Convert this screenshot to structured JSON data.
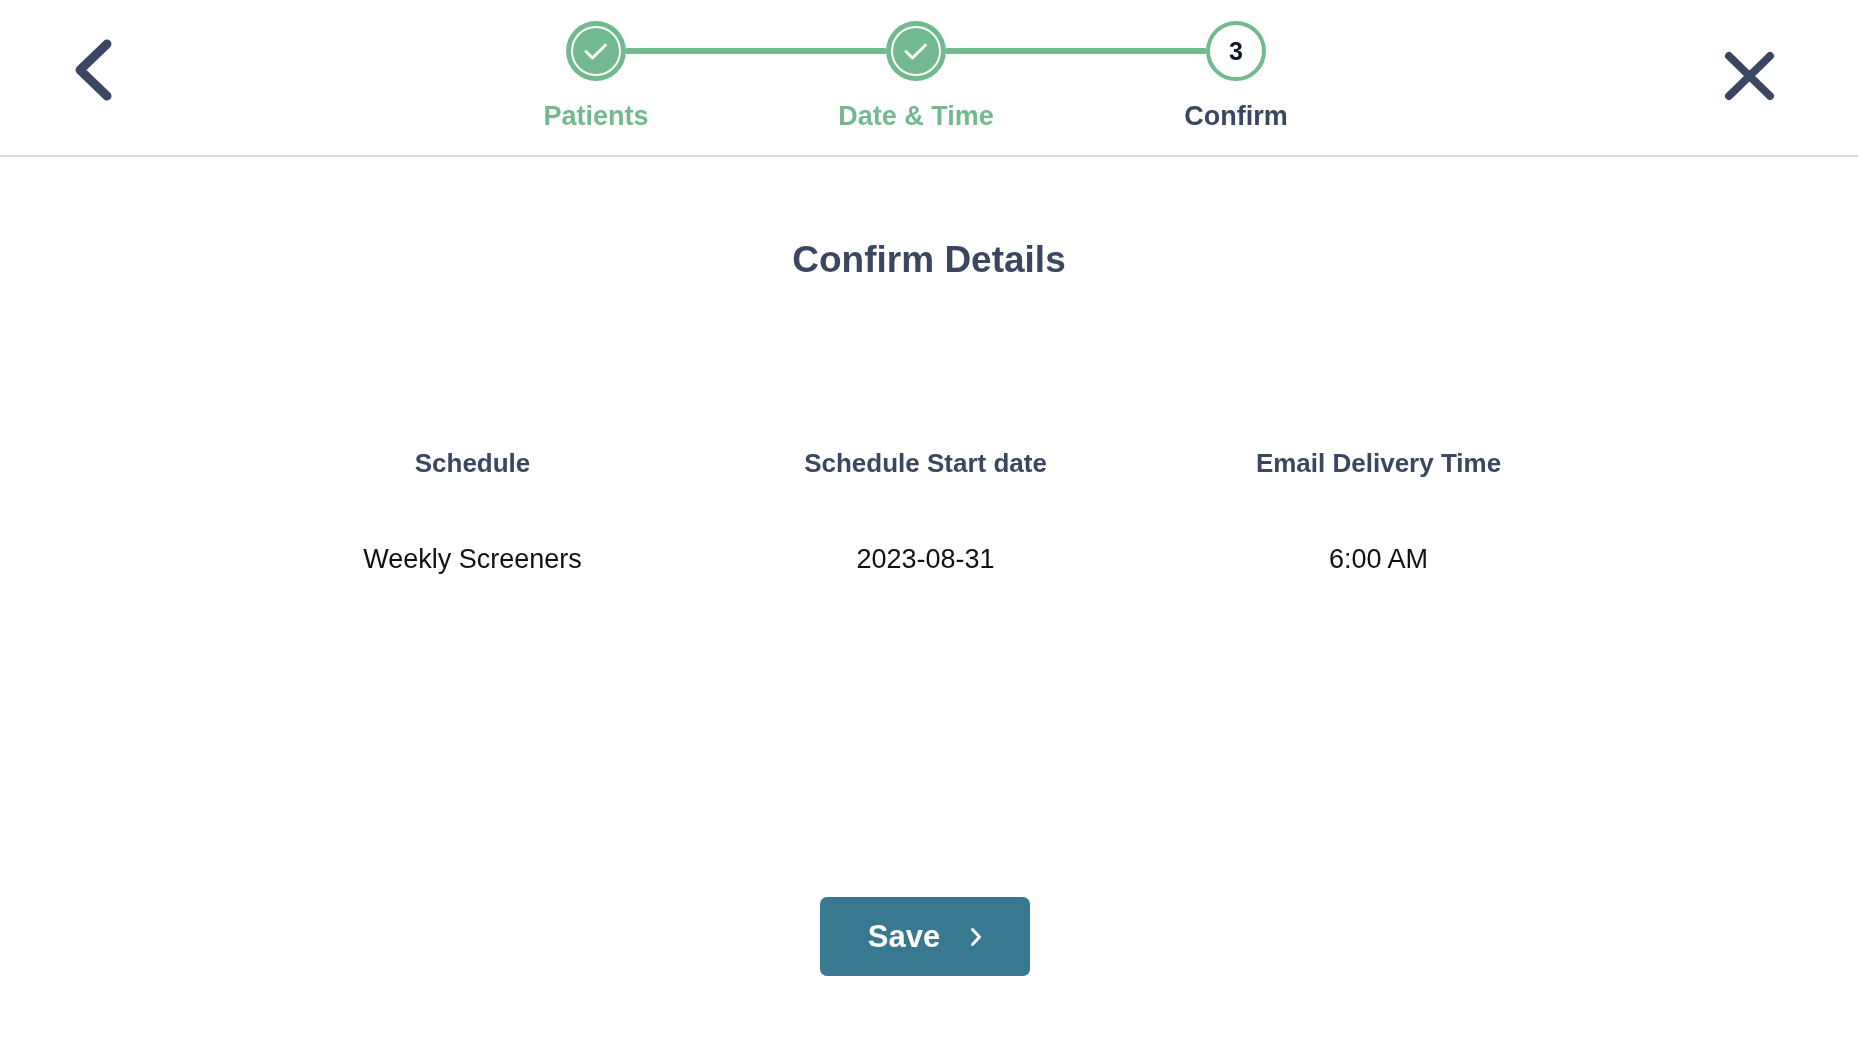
{
  "stepper": {
    "steps": [
      {
        "label": "Patients",
        "completed": true,
        "selected": false
      },
      {
        "label": "Date & Time",
        "completed": true,
        "selected": false
      },
      {
        "label": "Confirm",
        "completed": false,
        "selected": true,
        "number": "3"
      }
    ]
  },
  "title": "Confirm Details",
  "summary": {
    "columns": [
      {
        "heading": "Schedule",
        "value": "Weekly Screeners"
      },
      {
        "heading": "Schedule Start date",
        "value": "2023-08-31"
      },
      {
        "heading": "Email Delivery Time",
        "value": "6:00 AM"
      }
    ]
  },
  "save_button": {
    "label": "Save"
  }
}
